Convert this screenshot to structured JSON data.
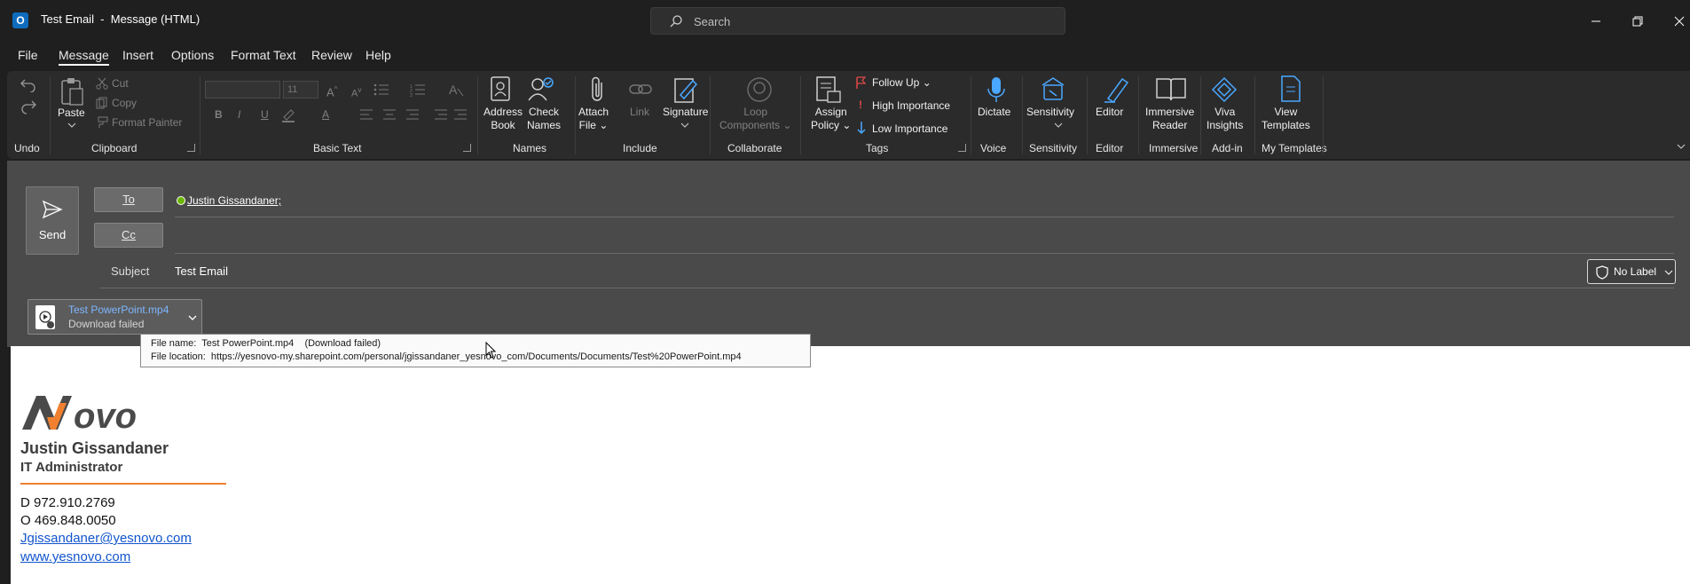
{
  "window": {
    "title": "Test Email  -  Message (HTML)",
    "search_placeholder": "Search",
    "app_icon_letter": "O"
  },
  "menu": {
    "items": [
      "File",
      "Message",
      "Insert",
      "Options",
      "Format Text",
      "Review",
      "Help"
    ],
    "active": "Message"
  },
  "ribbon": {
    "undo_group": "Undo",
    "clipboard": {
      "paste": "Paste",
      "cut": "Cut",
      "copy": "Copy",
      "format_painter": "Format Painter",
      "group": "Clipboard"
    },
    "basic_text": {
      "font_size": "11",
      "bold": "B",
      "italic": "I",
      "underline": "U",
      "font_color": "A",
      "group": "Basic Text"
    },
    "names": {
      "address_book_1": "Address",
      "address_book_2": "Book",
      "check_names_1": "Check",
      "check_names_2": "Names",
      "group": "Names"
    },
    "include": {
      "attach_1": "Attach",
      "attach_2": "File",
      "link": "Link",
      "signature": "Signature",
      "group": "Include"
    },
    "collaborate": {
      "loop_1": "Loop",
      "loop_2": "Components",
      "group": "Collaborate"
    },
    "tags": {
      "assign_1": "Assign",
      "assign_2": "Policy",
      "follow_up": "Follow Up",
      "high_importance": "High Importance",
      "low_importance": "Low Importance",
      "group": "Tags"
    },
    "voice": {
      "dictate": "Dictate",
      "group": "Voice"
    },
    "sensitivity": {
      "button": "Sensitivity",
      "group": "Sensitivity"
    },
    "editor": {
      "button": "Editor",
      "group": "Editor"
    },
    "immersive": {
      "button_1": "Immersive",
      "button_2": "Reader",
      "group": "Immersive"
    },
    "addin": {
      "viva_1": "Viva",
      "viva_2": "Insights",
      "group": "Add-in"
    },
    "templates": {
      "view_1": "View",
      "view_2": "Templates",
      "group": "My Templates"
    },
    "accent": "#4aa8ff"
  },
  "compose": {
    "send_label": "Send",
    "to_label": "To",
    "cc_label": "Cc",
    "to_recipient": "Justin Gissandaner;",
    "subject_label": "Subject",
    "subject_value": "Test Email",
    "sensitivity_label": "No Label"
  },
  "attachment": {
    "name": "Test PowerPoint.mp4",
    "status": "Download failed",
    "tooltip_name_label": "File name:",
    "tooltip_name_value": "Test PowerPoint.mp4    (Download failed)",
    "tooltip_location_label": "File location:",
    "tooltip_location_value": "https://yesnovo-my.sharepoint.com/personal/jgissandaner_yesnovo_com/Documents/Documents/Test%20PowerPoint.mp4"
  },
  "signature": {
    "logo_text": "Novo",
    "name": "Justin Gissandaner",
    "title": "IT Administrator",
    "direct": "D 972.910.2769",
    "office": "O 469.848.0050",
    "email": "Jgissandaner@yesnovo.com",
    "website": "www.yesnovo.com",
    "accent": "#f08030"
  }
}
